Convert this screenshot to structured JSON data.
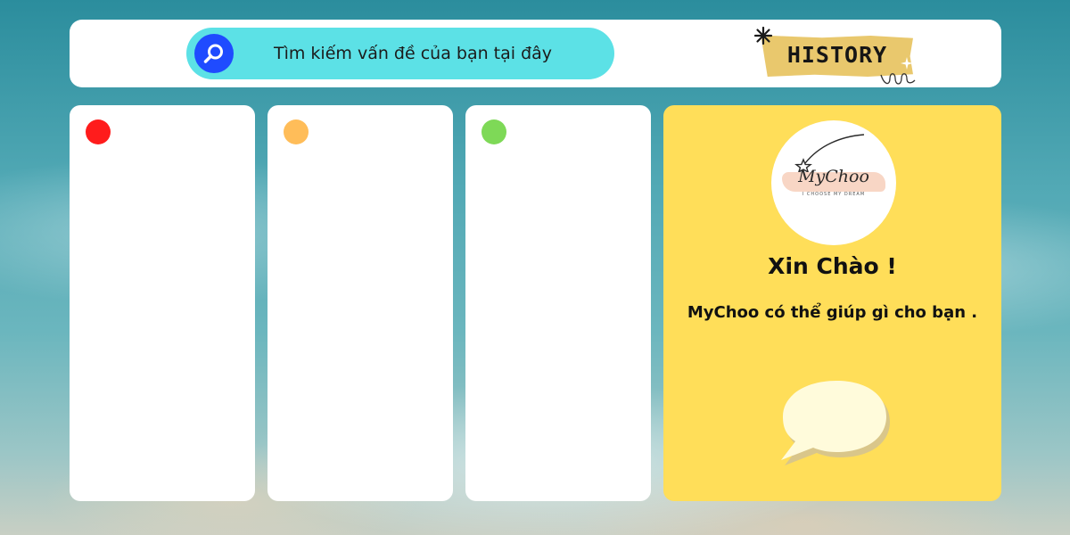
{
  "search": {
    "text": "Tìm kiếm vấn đề của bạn tại đây",
    "icon": "search-icon",
    "pill_color": "#5ce1e6",
    "button_color": "#1f4bff"
  },
  "history": {
    "label": "HISTORY",
    "tape_color": "#e9c86d"
  },
  "columns": [
    {
      "dot_color": "#ff1c1c"
    },
    {
      "dot_color": "#ffbd59"
    },
    {
      "dot_color": "#7ed957"
    }
  ],
  "welcome": {
    "panel_color": "#ffde59",
    "logo": {
      "name": "MyChoo",
      "tagline": "I CHOOSE MY DREAM"
    },
    "greeting": "Xin Chào !",
    "subtitle": "MyChoo có thể giúp gì cho bạn .",
    "chat_icon": "chat-bubble-icon"
  }
}
